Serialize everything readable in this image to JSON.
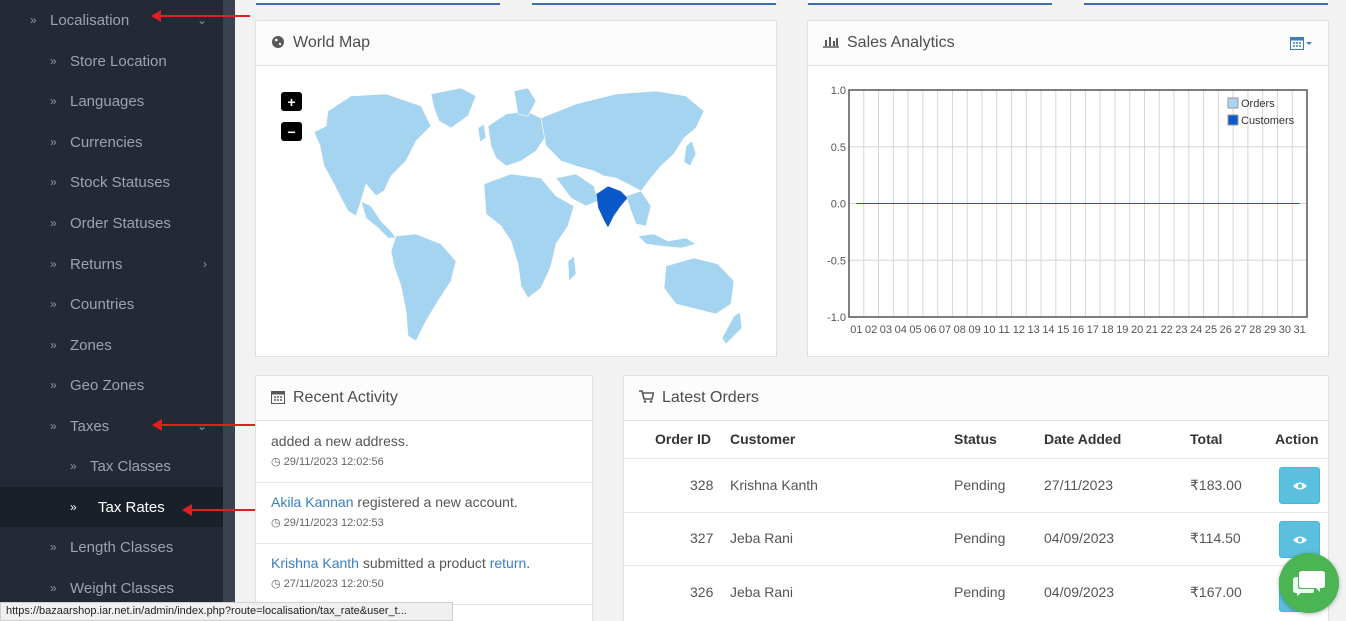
{
  "sidebar": {
    "parent": {
      "label": "Localisation"
    },
    "items": [
      {
        "label": "Store Location"
      },
      {
        "label": "Languages"
      },
      {
        "label": "Currencies"
      },
      {
        "label": "Stock Statuses"
      },
      {
        "label": "Order Statuses"
      },
      {
        "label": "Returns"
      },
      {
        "label": "Countries"
      },
      {
        "label": "Zones"
      },
      {
        "label": "Geo Zones"
      },
      {
        "label": "Taxes"
      },
      {
        "label": "Tax Classes"
      },
      {
        "label": "Tax Rates"
      },
      {
        "label": "Length Classes"
      },
      {
        "label": "Weight Classes"
      }
    ]
  },
  "world_map": {
    "title": "World Map",
    "highlight_color": "#0b59c9",
    "land_color": "#a5d4f0",
    "zoom_in": "+",
    "zoom_out": "−"
  },
  "sales": {
    "title": "Sales Analytics"
  },
  "chart_data": {
    "type": "line",
    "x": [
      "01",
      "02",
      "03",
      "04",
      "05",
      "06",
      "07",
      "08",
      "09",
      "10",
      "11",
      "12",
      "13",
      "14",
      "15",
      "16",
      "17",
      "18",
      "19",
      "20",
      "21",
      "22",
      "23",
      "24",
      "25",
      "26",
      "27",
      "28",
      "29",
      "30",
      "31"
    ],
    "yticks": [
      "1.0",
      "0.5",
      "0.0",
      "-0.5",
      "-1.0"
    ],
    "ylim": [
      -1,
      1
    ],
    "series": [
      {
        "name": "Orders",
        "color": "#a9d4f2",
        "values": [
          0,
          0,
          0,
          0,
          0,
          0,
          0,
          0,
          0,
          0,
          0,
          0,
          0,
          0,
          0,
          0,
          0,
          0,
          0,
          0,
          0,
          0,
          0,
          0,
          0,
          0,
          0,
          0,
          0,
          0,
          0
        ]
      },
      {
        "name": "Customers",
        "color": "#0b59c9",
        "values": [
          0,
          0,
          0,
          0,
          0,
          0,
          0,
          0,
          0,
          0,
          0,
          0,
          0,
          0,
          0,
          0,
          0,
          0,
          0,
          0,
          0,
          0,
          0,
          0,
          0,
          0,
          0,
          0,
          0,
          0,
          0
        ]
      }
    ],
    "legend": "top-right"
  },
  "activity": {
    "title": "Recent Activity",
    "items": [
      {
        "text": "added a new address.",
        "time": "29/11/2023 12:02:56"
      },
      {
        "link": "Akila Kannan",
        "text": " registered a new account.",
        "time": "29/11/2023 12:02:53"
      },
      {
        "link": "Krishna Kanth",
        "text": " submitted a product ",
        "link2": "return",
        "text2": ".",
        "time": "27/11/2023 12:20:50"
      }
    ]
  },
  "orders": {
    "title": "Latest Orders",
    "headers": {
      "id": "Order ID",
      "customer": "Customer",
      "status": "Status",
      "date": "Date Added",
      "total": "Total",
      "action": "Action"
    },
    "rows": [
      {
        "id": "328",
        "customer": "Krishna Kanth",
        "status": "Pending",
        "date": "27/11/2023",
        "total": "₹183.00"
      },
      {
        "id": "327",
        "customer": "Jeba Rani",
        "status": "Pending",
        "date": "04/09/2023",
        "total": "₹114.50"
      },
      {
        "id": "326",
        "customer": "Jeba Rani",
        "status": "Pending",
        "date": "04/09/2023",
        "total": "₹167.00"
      }
    ]
  },
  "statusbar": {
    "url": "https://bazaarshop.iar.net.in/admin/index.php?route=localisation/tax_rate&user_t..."
  }
}
